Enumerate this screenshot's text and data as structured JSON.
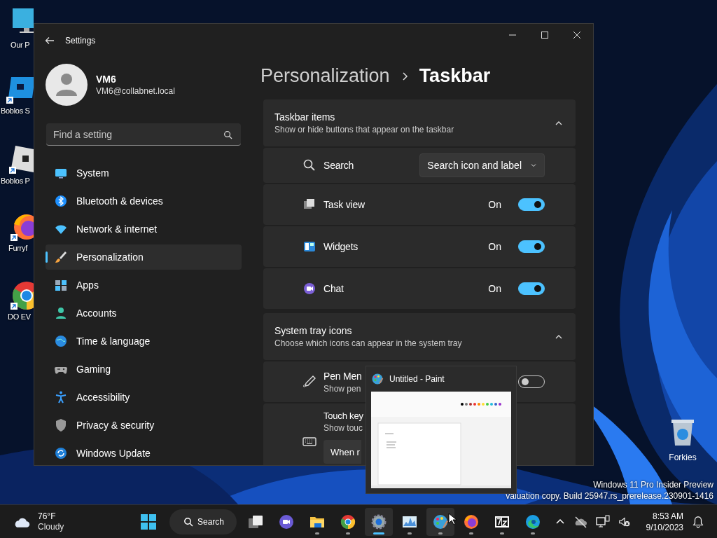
{
  "desktop_icons": [
    {
      "label": "Our P"
    },
    {
      "label": "Boblos S"
    },
    {
      "label": "Boblos P"
    },
    {
      "label": "Furryf"
    },
    {
      "label": "DO EV"
    },
    {
      "label": "Forkies"
    }
  ],
  "settings_window": {
    "title": "Settings",
    "user": {
      "name": "VM6",
      "email": "VM6@collabnet.local"
    },
    "search": {
      "placeholder": "Find a setting"
    },
    "nav_items": [
      {
        "label": "System",
        "selected": false
      },
      {
        "label": "Bluetooth & devices",
        "selected": false
      },
      {
        "label": "Network & internet",
        "selected": false
      },
      {
        "label": "Personalization",
        "selected": true
      },
      {
        "label": "Apps",
        "selected": false
      },
      {
        "label": "Accounts",
        "selected": false
      },
      {
        "label": "Time & language",
        "selected": false
      },
      {
        "label": "Gaming",
        "selected": false
      },
      {
        "label": "Accessibility",
        "selected": false
      },
      {
        "label": "Privacy & security",
        "selected": false
      },
      {
        "label": "Windows Update",
        "selected": false
      }
    ],
    "breadcrumb": [
      "Personalization",
      "Taskbar"
    ],
    "sections": [
      {
        "title": "Taskbar items",
        "subtitle": "Show or hide buttons that appear on the taskbar",
        "expanded": true,
        "rows": [
          {
            "kind": "dropdown",
            "label": "Search",
            "value": "Search icon and label"
          },
          {
            "kind": "toggle",
            "label": "Task view",
            "state_label": "On",
            "on": true
          },
          {
            "kind": "toggle",
            "label": "Widgets",
            "state_label": "On",
            "on": true
          },
          {
            "kind": "toggle",
            "label": "Chat",
            "state_label": "On",
            "on": true
          }
        ]
      },
      {
        "title": "System tray icons",
        "subtitle": "Choose which icons can appear in the system tray",
        "expanded": true,
        "rows": [
          {
            "kind": "toggle",
            "label": "Pen Men",
            "description": "Show pen",
            "on": false
          },
          {
            "kind": "dropdown-below",
            "label": "Touch key",
            "description": "Show touc",
            "value": "When r"
          }
        ]
      }
    ]
  },
  "thumbnail_popup": {
    "title": "Untitled - Paint"
  },
  "watermark": [
    "Windows 11 Pro Insider Preview",
    "valuation copy. Build 25947.rs_prerelease.230901-1416"
  ],
  "taskbar": {
    "weather": {
      "temperature": "76°F",
      "condition": "Cloudy"
    },
    "search_label": "Search",
    "apps": [
      {
        "running": false,
        "active": false,
        "hovered": false
      },
      {
        "running": false,
        "active": false,
        "hovered": false
      },
      {
        "running": true,
        "active": false,
        "hovered": false
      },
      {
        "running": true,
        "active": false,
        "hovered": false
      },
      {
        "running": true,
        "active": true,
        "hovered": false
      },
      {
        "running": true,
        "active": false,
        "hovered": false
      },
      {
        "running": true,
        "active": false,
        "hovered": true
      },
      {
        "running": true,
        "active": false,
        "hovered": false
      },
      {
        "running": true,
        "active": false,
        "hovered": false
      },
      {
        "running": true,
        "active": false,
        "hovered": false
      }
    ],
    "time": "8:53 AM",
    "date": "9/10/2023"
  }
}
